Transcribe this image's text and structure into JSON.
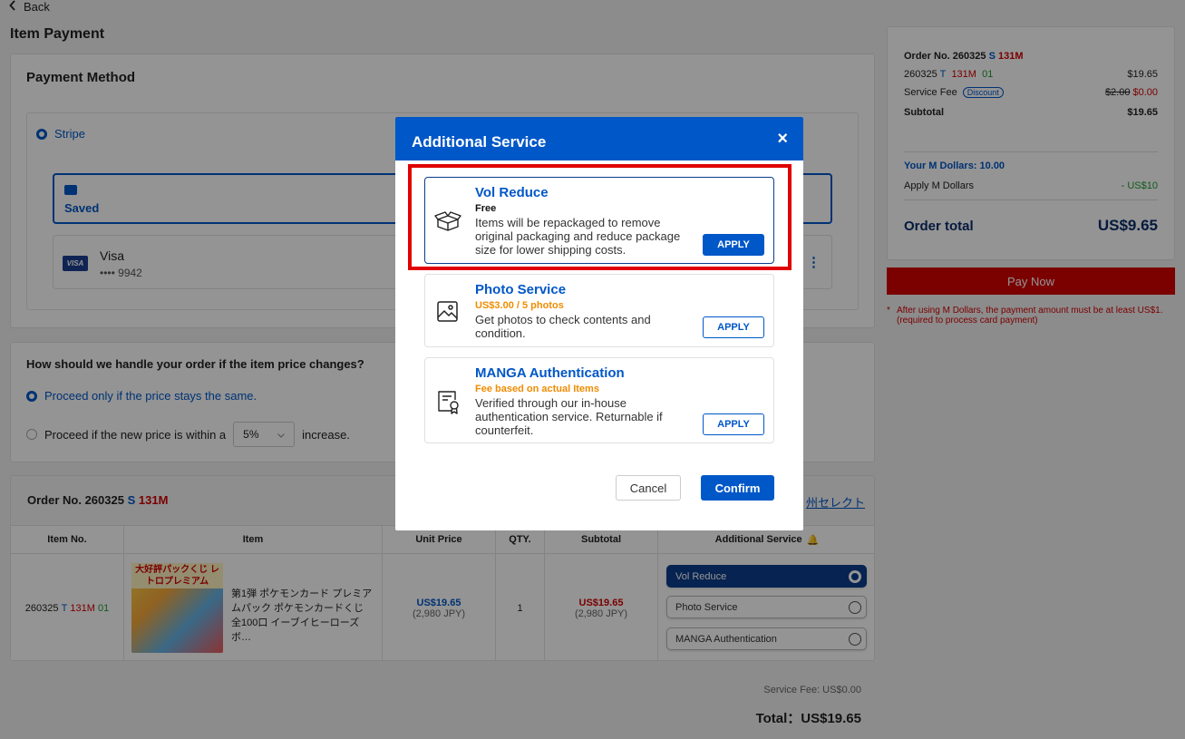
{
  "page": {
    "back_label": "Back",
    "title": "Item Payment"
  },
  "payment_method": {
    "title": "Payment Method",
    "option": "Stripe",
    "saved_label": "Saved",
    "card_brand": "Visa",
    "card_brand_logo": "VISA",
    "card_number": "•••• 9942",
    "more_icon": "vertical-dots"
  },
  "price_change": {
    "question": "How should we handle your order if the item price changes?",
    "option1": "Proceed only if the price stays the same.",
    "option2_prefix": "Proceed if the new price is within a",
    "option2_value": "5%",
    "option2_suffix": "increase."
  },
  "order": {
    "title_prefix": "Order No. 260325",
    "title_s": "S",
    "title_code": "131M",
    "store_link": "州セレクト",
    "columns": [
      "Item No.",
      "Item",
      "Unit Price",
      "QTY.",
      "Subtotal",
      "Additional Service"
    ],
    "bell_icon": "bell-icon",
    "row": {
      "item_no_base": "260325",
      "item_no_t": "T",
      "item_no_code": "131M",
      "item_no_suffix": "01",
      "thumb_caption": "大好評パックくじ レトロプレミアム",
      "item_name": "第1弾 ポケモンカード プレミアムパック ポケモンカードくじ 全100口 イーブイヒーローズ ボ…",
      "unit_price": "US$19.65",
      "unit_price_jpy": "(2,980 JPY)",
      "qty": "1",
      "subtotal": "US$19.65",
      "subtotal_jpy": "(2,980 JPY)",
      "services": [
        "Vol Reduce",
        "Photo Service",
        "MANGA Authentication"
      ]
    },
    "service_fee": "Service Fee: US$0.00",
    "total": "Total：US$19.65"
  },
  "summary": {
    "order_no_prefix": "Order No. 260325",
    "order_no_s": "S",
    "order_no_code": "131M",
    "item_base": "260325",
    "item_t": "T",
    "item_code": "131M",
    "item_suffix": "01",
    "item_price": "$19.65",
    "service_fee_label": "Service Fee",
    "discount_badge": "Discount",
    "service_fee_old": "$2.00",
    "service_fee_new": "$0.00",
    "subtotal_label": "Subtotal",
    "subtotal_value": "$19.65",
    "m_dollars": "Your M Dollars: 10.00",
    "apply_m_label": "Apply M Dollars",
    "apply_m_value": "- US$10",
    "order_total_label": "Order total",
    "order_total_value": "US$9.65",
    "pay_now": "Pay Now",
    "note_line1": "After using M Dollars, the payment amount must be at least US$1.",
    "note_line2": "(required to process card payment)"
  },
  "modal": {
    "title": "Additional Service",
    "close": "×",
    "services": [
      {
        "name": "Vol Reduce",
        "price": "Free",
        "description": "Items will be repackaged to remove original packaging and reduce package size for lower shipping costs.",
        "apply": "APPLY",
        "icon": "box-icon"
      },
      {
        "name": "Photo Service",
        "price": "US$3.00 / 5 photos",
        "description": "Get photos to check contents and condition.",
        "apply": "APPLY",
        "icon": "image-icon"
      },
      {
        "name": "MANGA Authentication",
        "price": "Fee based on actual Items",
        "description": "Verified through our in-house authentication service. Returnable if counterfeit.",
        "apply": "APPLY",
        "icon": "certificate-icon"
      }
    ],
    "cancel": "Cancel",
    "confirm": "Confirm"
  },
  "colors": {
    "primary": "#0057c8",
    "navy": "#0b3d8c",
    "danger": "#d40000",
    "highlight": "#e00000",
    "orange": "#f08c00"
  }
}
